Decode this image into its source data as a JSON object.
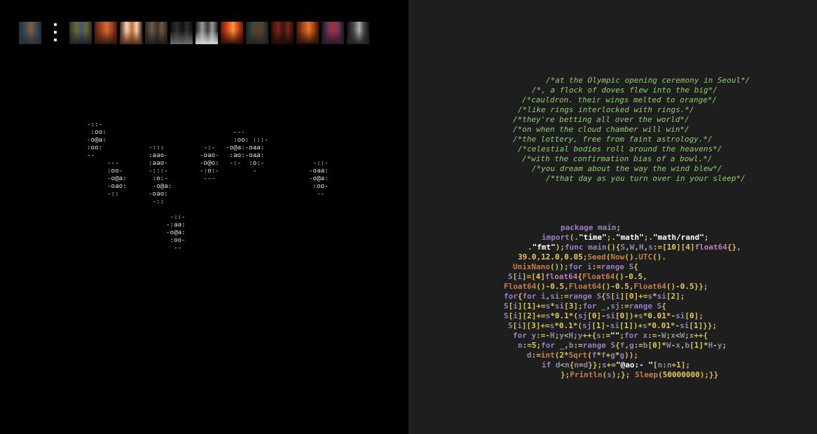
{
  "gallery": {
    "thumbnails": [
      {
        "name": "thumbnail-1",
        "colors": [
          "#1f2e3a",
          "#3b4e5a",
          "#8a5a33",
          "#2a2f36"
        ]
      },
      {
        "name": "thumbnail-2",
        "colors": [
          "#2e3320",
          "#6a6a2e",
          "#3d5a78",
          "#1c2230"
        ]
      },
      {
        "name": "thumbnail-3",
        "colors": [
          "#4a1f12",
          "#a94620",
          "#d46b2f",
          "#30140c"
        ]
      },
      {
        "name": "thumbnail-4",
        "colors": [
          "#3a2216",
          "#f3d6b5",
          "#c86a2d",
          "#5a2a14"
        ]
      },
      {
        "name": "thumbnail-5",
        "colors": [
          "#2a2420",
          "#6e5a48",
          "#3c332c",
          "#1e1a18"
        ]
      },
      {
        "name": "thumbnail-6",
        "colors": [
          "#0c0c0c",
          "#2e2e2e",
          "#111111",
          "#6a6a6a"
        ]
      },
      {
        "name": "thumbnail-7",
        "colors": [
          "#1a1a1a",
          "#9a9a9a",
          "#3a3a3a",
          "#d8d8d8"
        ]
      },
      {
        "name": "thumbnail-8",
        "colors": [
          "#5a1a0c",
          "#e0461a",
          "#f29a38",
          "#2a0a06"
        ]
      },
      {
        "name": "thumbnail-9",
        "colors": [
          "#1a1f1a",
          "#3e4a3a",
          "#6a3a2a",
          "#22261e"
        ]
      },
      {
        "name": "thumbnail-10",
        "colors": [
          "#2a0f0c",
          "#7a2416",
          "#3a1410",
          "#1a0806"
        ]
      },
      {
        "name": "thumbnail-11",
        "colors": [
          "#3a1406",
          "#b04818",
          "#e0782c",
          "#2a0e06"
        ]
      },
      {
        "name": "thumbnail-12",
        "colors": [
          "#1a1420",
          "#6a3a5a",
          "#b02a3a",
          "#2a1a2a"
        ]
      },
      {
        "name": "thumbnail-13",
        "colors": [
          "#0e0e0e",
          "#4a4a4a",
          "#b0b0b0",
          "#222222"
        ]
      }
    ],
    "menu_icon": "vertical-ellipsis-icon"
  },
  "boids": [
    {
      "name": "ascii-flock-1",
      "text": "-::-\n :oo:\n-o@a:\n:oo:\n--"
    },
    {
      "name": "ascii-flock-2",
      "text": "---\n:oo-\n-o@a:\n-oao:\n-::"
    },
    {
      "name": "ascii-flock-3",
      "text": "-:::\n:aao-\n:aao-\n-:::-\n :o:-\n -o@a:\n-oao:\n -::"
    },
    {
      "name": "ascii-flock-4",
      "text": " -:-\n-oao-\n-o@o:\n-:o:-\n ---"
    },
    {
      "name": "ascii-flock-5",
      "text": "  ---\n  :oo: :::-\n-o@a:-oaa:\n :ao:-oaa:\n -:-  :o:-\n       -"
    },
    {
      "name": "ascii-flock-6",
      "text": " -::-\n-oaa:\n-o@a:\n :oo-\n  --"
    },
    {
      "name": "ascii-flock-7",
      "text": " -::-\n-:aa:\n-o@a:\n :oo-\n  --"
    }
  ],
  "poem": {
    "lines": [
      "/*at the Olympic opening ceremony in Seoul*/",
      "/*, a flock of doves flew into the big*/",
      "/*cauldron. their wings melted to orange*/",
      "/*like rings interlocked with rings.*/",
      "/*they're betting all over the world*/",
      "/*on when the cloud chamber will win*/",
      "/*the lottery, free from faint astrology.*/",
      "/*celestial bodies roll around the heavens*/",
      "/*with the confirmation bias of a bowl.*/",
      "/*you dream about the way the wind blew*/",
      "/*that day as you turn over in your sleep*/"
    ]
  },
  "code": {
    "lines": [
      "package main;",
      "import(.\"time\";.\"math\";.\"math/rand\";",
      ".\"fmt\");func main(){S,W,H,s:=[10][4]float64{},",
      "39.0,12.0,0.05;Seed(Now().UTC().",
      "UnixNano());for i:=range S{",
      "S[i]=[4]float64{Float64()-0.5,",
      "Float64()-0.5,Float64()-0.5,Float64()-0.5}};",
      "for{for i,si:=range S{S[i][0]+=s*si[2];",
      "S[i][1]+=s*si[3];for _,sj:=range S{",
      "S[i][2]+=s*0.1*(sj[0]-si[0])+s*0.01*-si[0];",
      "S[i][3]+=s*0.1*(sj[1]-si[1])+s*0.01*-si[1]}};",
      "for y:=-H;y<H;y++{s:=\"\";for x:=-W;x<W;x++{",
      "n:=5;for _,b:=range S{f,g:=b[0]*W-x,b[1]*H-y;",
      "d:=int(2*Sqrt(f*f+g*g));",
      "if d<n{n=d}};s+=\"@ao:- \"[n:n+1];",
      "};Println(s);}; Sleep(50000000);}}"
    ]
  },
  "colors": {
    "left_bg": "#000000",
    "right_bg": "#1e1e1e",
    "poem_text": "#8ccf6e",
    "code_keyword": "#9a7ec7",
    "code_string": "#ffffff",
    "code_number": "#e9c85a",
    "code_type": "#c77ab6",
    "code_function": "#c67d48"
  }
}
